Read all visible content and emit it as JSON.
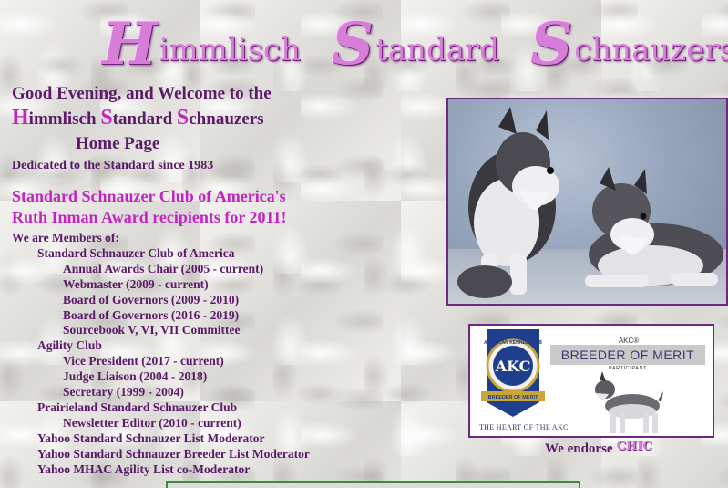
{
  "banner": {
    "word1": {
      "initial": "H",
      "rest": "immlisch"
    },
    "word2": {
      "initial": "S",
      "rest": "tandard"
    },
    "word3": {
      "initial": "S",
      "rest": "chnauzers"
    }
  },
  "welcome": {
    "line1": "Good Evening, and Welcome to the",
    "name_parts": [
      {
        "cap": "H",
        "rest": "immlisch "
      },
      {
        "cap": "S",
        "rest": "tandard "
      },
      {
        "cap": "S",
        "rest": "chnauzers"
      }
    ],
    "line3": "Home Page",
    "dedication": "Dedicated to the Standard since 1983"
  },
  "award": {
    "line1": "Standard Schnauzer Club of America's",
    "line2": "Ruth Inman Award recipients for 2011!"
  },
  "members": {
    "heading": "We are Members of:",
    "items": [
      {
        "level": 1,
        "text": "Standard Schnauzer Club of America"
      },
      {
        "level": 2,
        "text": "Annual Awards Chair (2005 - current)"
      },
      {
        "level": 2,
        "text": "Webmaster (2009 - current)"
      },
      {
        "level": 2,
        "text": "Board of Governors (2009 - 2010)"
      },
      {
        "level": 2,
        "text": "Board of Governors (2016 - 2019)"
      },
      {
        "level": 2,
        "text": "Sourcebook V, VI, VII Committee"
      },
      {
        "level": 1,
        "text": "Agility Club"
      },
      {
        "level": 2,
        "text": "Vice President (2017 - current)"
      },
      {
        "level": 2,
        "text": "Judge Liaison (2004 - 2018)"
      },
      {
        "level": 2,
        "text": "Secretary (1999 - 2004)"
      },
      {
        "level": 1,
        "text": "Prairieland Standard Schnauzer Club"
      },
      {
        "level": 2,
        "text": "Newsletter Editor (2010 - current)"
      },
      {
        "level": 1,
        "text": "Yahoo Standard Schnauzer List Moderator"
      },
      {
        "level": 1,
        "text": "Yahoo Standard Schnauzer Breeder List Moderator"
      },
      {
        "level": 1,
        "text": "Yahoo MHAC Agility List co-Moderator"
      }
    ]
  },
  "merit_badge": {
    "akc_small": "AKC®",
    "title": "BREEDER OF MERIT",
    "subtitle": "PARTICIPANT",
    "ribbon_ring": "AMERICAN KENNEL CLUB",
    "ribbon_center": "AKC",
    "ribbon_banner": "BREEDER OF MERIT",
    "tagline": "THE HEART OF THE AKC"
  },
  "endorse": {
    "label": "We endorse",
    "logo_text": "CHIC"
  },
  "colors": {
    "title_purple": "#c026c0",
    "text_purple": "#5a1a68",
    "banner_pink": "#d77ed9",
    "border_purple": "#6b2a7b",
    "ribbon_blue": "#1f3f8c"
  }
}
